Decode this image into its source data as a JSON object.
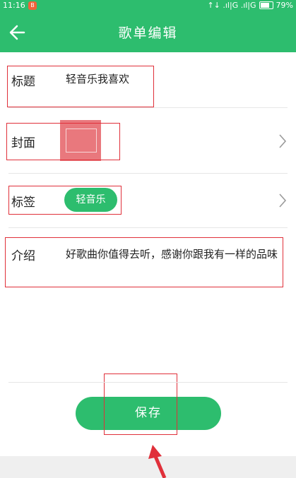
{
  "status_bar": {
    "time": "11:16",
    "notification": "B",
    "network": "↑↓ .ıl|G .ıl|G",
    "battery": "79%"
  },
  "header": {
    "title": "歌单编辑",
    "back_icon": "arrow-left-icon"
  },
  "form": {
    "title": {
      "label": "标题",
      "value": "轻音乐我喜欢"
    },
    "cover": {
      "label": "封面",
      "chevron_icon": "chevron-right-icon"
    },
    "tags": {
      "label": "标签",
      "tag": "轻音乐",
      "chevron_icon": "chevron-right-icon"
    },
    "intro": {
      "label": "介绍",
      "value": "好歌曲你值得去听，感谢你跟我有一样的品味"
    }
  },
  "save_label": "保存",
  "colors": {
    "primary": "#2dbd6e",
    "annotation": "#e0303a"
  }
}
